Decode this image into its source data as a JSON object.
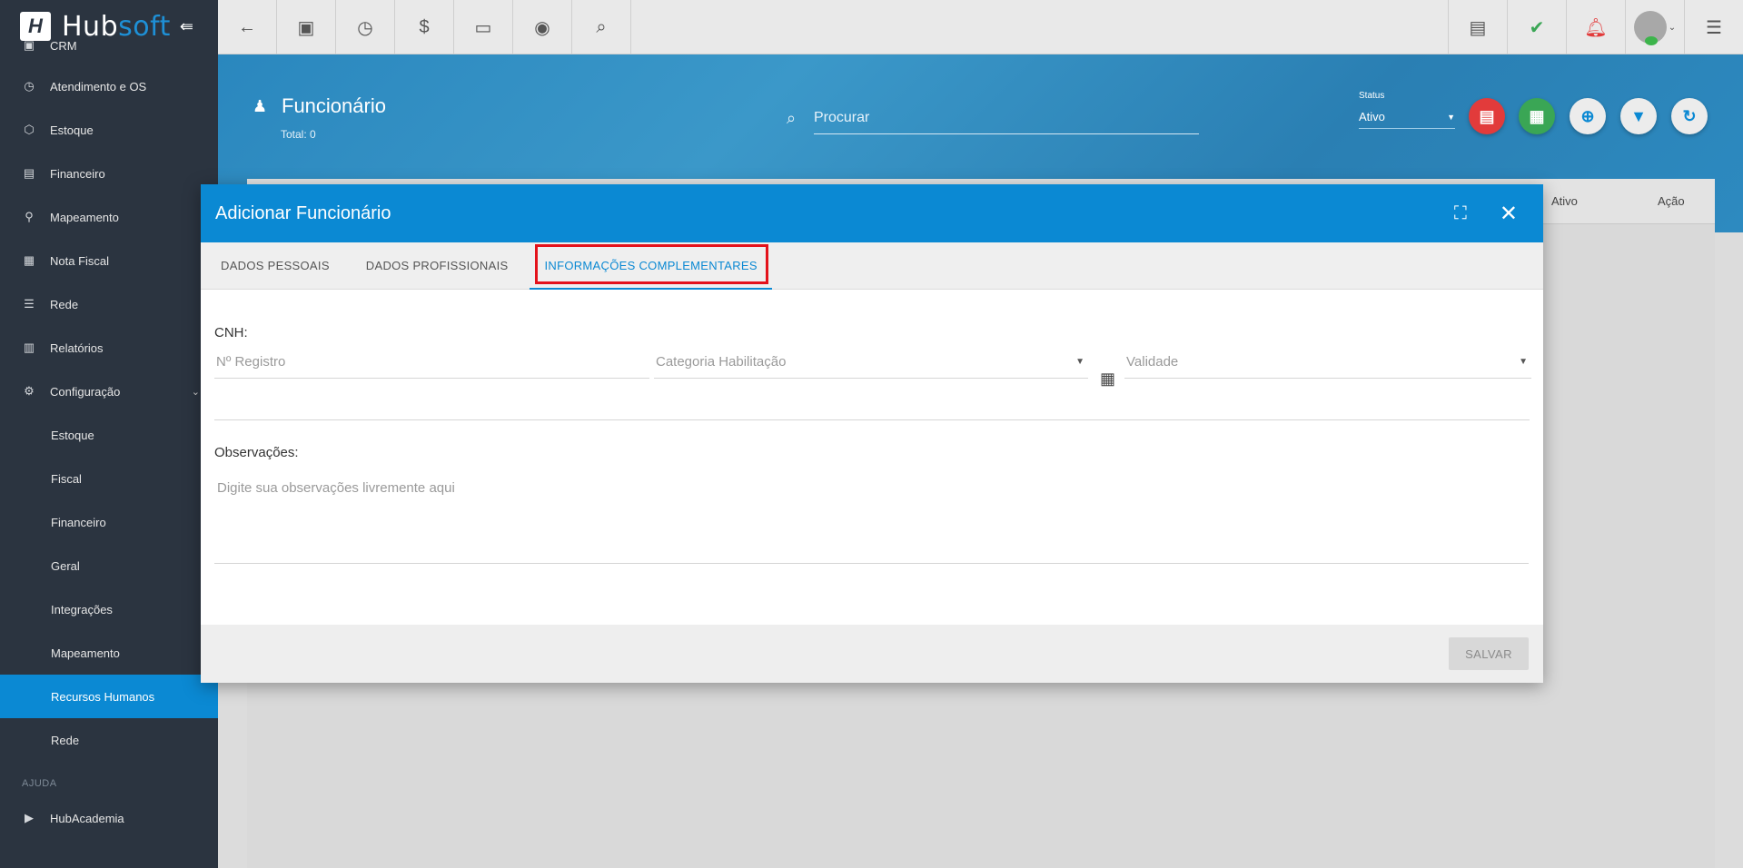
{
  "brand": {
    "name_main": "Hub",
    "name_accent": "soft"
  },
  "sidebar": {
    "items": [
      {
        "label": "CRM",
        "icon": "trello-board-icon"
      },
      {
        "label": "Atendimento e OS",
        "icon": "calendar-clock-icon"
      },
      {
        "label": "Estoque",
        "icon": "cube-icon"
      },
      {
        "label": "Financeiro",
        "icon": "money-icon"
      },
      {
        "label": "Mapeamento",
        "icon": "map-pin-icon"
      },
      {
        "label": "Nota Fiscal",
        "icon": "document-icon"
      },
      {
        "label": "Rede",
        "icon": "server-icon"
      },
      {
        "label": "Relatórios",
        "icon": "report-icon"
      },
      {
        "label": "Configuração",
        "icon": "gear-icon"
      }
    ],
    "subitems": [
      "Estoque",
      "Fiscal",
      "Financeiro",
      "Geral",
      "Integrações",
      "Mapeamento",
      "Recursos Humanos",
      "Rede"
    ],
    "section": "AJUDA",
    "help_item": "HubAcademia"
  },
  "header": {
    "title": "Funcionário",
    "total": "Total: 0",
    "search_placeholder": "Procurar",
    "status_label": "Status",
    "status_value": "Ativo"
  },
  "table": {
    "columns": [
      "Ativo",
      "Ação"
    ]
  },
  "modal": {
    "title": "Adicionar Funcionário",
    "tabs": [
      "DADOS PESSOAIS",
      "DADOS PROFISSIONAIS",
      "INFORMAÇÕES COMPLEMENTARES"
    ],
    "cnh_label": "CNH:",
    "registro_placeholder": "Nº Registro",
    "categoria_placeholder": "Categoria Habilitação",
    "validade_placeholder": "Validade",
    "obs_label": "Observações:",
    "obs_placeholder": "Digite sua observações livremente aqui",
    "save_label": "SALVAR"
  },
  "colors": {
    "primary": "#0b89d3",
    "sidebar_bg": "#2b3440",
    "highlight": "#e3121b",
    "fab_red": "#e23b3b",
    "fab_green": "#3aa655"
  }
}
